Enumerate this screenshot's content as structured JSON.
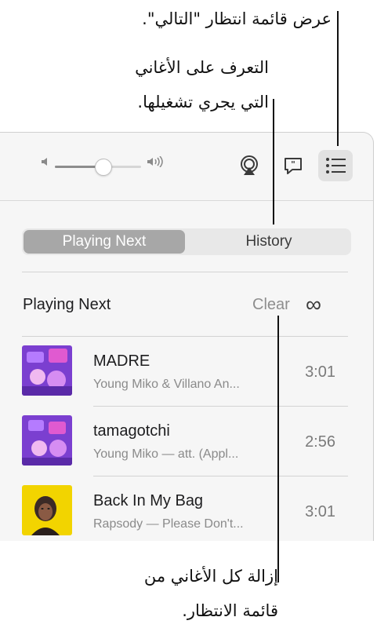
{
  "callouts": {
    "queue": "عرض قائمة انتظار \"التالي\".",
    "lyrics_line1": "التعرف على الأغاني",
    "lyrics_line2": "التي يجري تشغيلها.",
    "clear_line1": "إزالة كل الأغاني من",
    "clear_line2": "قائمة الانتظار."
  },
  "toolbar": {
    "volume_icon_low": "speaker-low-icon",
    "volume_icon_high": "speaker-high-icon",
    "volume_level": 0.55,
    "airplay_icon": "airplay-icon",
    "lyrics_icon": "lyrics-bubble-icon",
    "queue_icon": "list-icon"
  },
  "tabs": [
    {
      "label": "Playing Next",
      "selected": true
    },
    {
      "label": "History",
      "selected": false
    }
  ],
  "section": {
    "title": "Playing Next",
    "clear_label": "Clear",
    "infinity_symbol": "∞"
  },
  "songs": [
    {
      "title": "MADRE",
      "subtitle": "Young Miko & Villano An...",
      "duration": "3:01",
      "art": "purple"
    },
    {
      "title": "tamagotchi",
      "subtitle": "Young Miko — att. (Appl...",
      "duration": "2:56",
      "art": "purple"
    },
    {
      "title": "Back In My Bag",
      "subtitle": "Rapsody — Please Don't...",
      "duration": "3:01",
      "art": "yellow"
    }
  ],
  "colors": {
    "selected_segment": "#a7a7a7",
    "panel_bg": "#f6f6f6",
    "art_purple": "#7b3fd0",
    "art_yellow": "#f2d400"
  }
}
